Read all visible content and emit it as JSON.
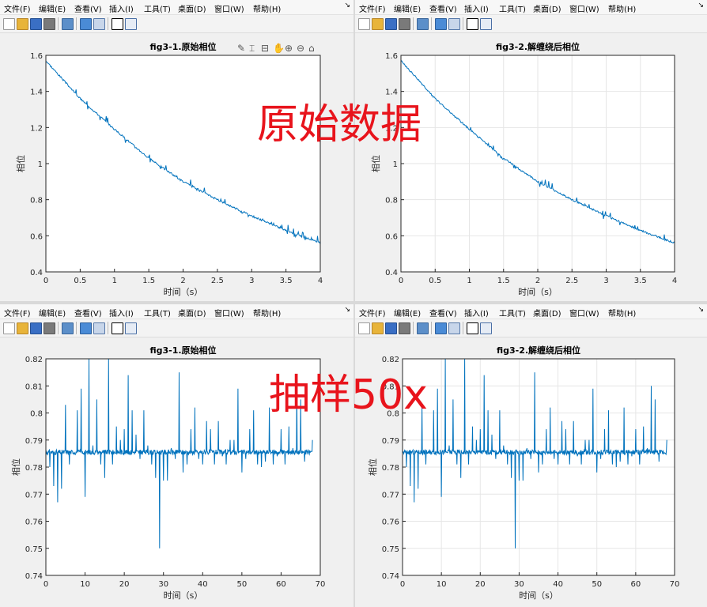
{
  "menu": [
    "文件(F)",
    "编辑(E)",
    "查看(V)",
    "插入(I)",
    "工具(T)",
    "桌面(D)",
    "窗口(W)",
    "帮助(H)"
  ],
  "menu_arrow": "↘",
  "overlay_top": "原始数据",
  "overlay_bottom": "抽样50x",
  "colors": {
    "line": "#0072bd",
    "overlay": "#e8141c",
    "grid": "#e6e6e6"
  },
  "windows": {
    "tl": {
      "chart": {
        "title": "fig3-1.原始相位",
        "xlabel": "时间（s）",
        "ylabel": "相位",
        "xticks": [
          "0",
          "0.5",
          "1",
          "1.5",
          "2",
          "2.5",
          "3",
          "3.5",
          "4"
        ],
        "yticks": [
          "0.4",
          "0.6",
          "0.8",
          "1",
          "1.2",
          "1.4",
          "1.6"
        ]
      }
    },
    "tr": {
      "chart": {
        "title": "fig3-2.解缠绕后相位",
        "xlabel": "时间（s）",
        "ylabel": "相位",
        "xticks": [
          "0",
          "0.5",
          "1",
          "1.5",
          "2",
          "2.5",
          "3",
          "3.5",
          "4"
        ],
        "yticks": [
          "0.4",
          "0.6",
          "0.8",
          "1",
          "1.2",
          "1.4",
          "1.6"
        ]
      }
    },
    "bl": {
      "chart": {
        "title": "fig3-1.原始相位",
        "xlabel": "时间（s）",
        "ylabel": "相位",
        "xticks": [
          "0",
          "10",
          "20",
          "30",
          "40",
          "50",
          "60",
          "70"
        ],
        "yticks": [
          "0.74",
          "0.75",
          "0.76",
          "0.77",
          "0.78",
          "0.79",
          "0.8",
          "0.81",
          "0.82"
        ]
      }
    },
    "br": {
      "chart": {
        "title": "fig3-2.解缠绕后相位",
        "xlabel": "时间（s）",
        "ylabel": "相位",
        "xticks": [
          "0",
          "10",
          "20",
          "30",
          "40",
          "50",
          "60",
          "70"
        ],
        "yticks": [
          "0.74",
          "0.75",
          "0.76",
          "0.77",
          "0.78",
          "0.79",
          "0.8",
          "0.81",
          "0.82"
        ]
      }
    }
  },
  "chart_data": [
    {
      "type": "line",
      "title": "fig3-1.原始相位",
      "xlabel": "时间（s）",
      "ylabel": "相位",
      "xlim": [
        0,
        4
      ],
      "ylim": [
        0.4,
        1.6
      ],
      "grid": false,
      "x": [
        0,
        0.5,
        1,
        1.5,
        2,
        2.5,
        3,
        3.5,
        4
      ],
      "series": [
        {
          "values": [
            1.57,
            1.36,
            1.19,
            1.03,
            0.9,
            0.8,
            0.71,
            0.63,
            0.56
          ]
        }
      ]
    },
    {
      "type": "line",
      "title": "fig3-2.解缠绕后相位",
      "xlabel": "时间（s）",
      "ylabel": "相位",
      "xlim": [
        0,
        4
      ],
      "ylim": [
        0.4,
        1.6
      ],
      "grid": true,
      "x": [
        0,
        0.5,
        1,
        1.5,
        2,
        2.5,
        3,
        3.5,
        4
      ],
      "series": [
        {
          "values": [
            1.57,
            1.36,
            1.19,
            1.03,
            0.9,
            0.8,
            0.71,
            0.63,
            0.56
          ]
        }
      ]
    },
    {
      "type": "line",
      "title": "fig3-1.原始相位",
      "xlabel": "时间（s）",
      "ylabel": "相位",
      "xlim": [
        0,
        70
      ],
      "ylim": [
        0.74,
        0.82
      ],
      "grid": false,
      "baseline": 0.7855,
      "spikes": [
        [
          1,
          0.78
        ],
        [
          2,
          0.773
        ],
        [
          3,
          0.767
        ],
        [
          4,
          0.772
        ],
        [
          5,
          0.803
        ],
        [
          6,
          0.781
        ],
        [
          7,
          0.785
        ],
        [
          8,
          0.801
        ],
        [
          9,
          0.809
        ],
        [
          10,
          0.769
        ],
        [
          11,
          0.82
        ],
        [
          12,
          0.788
        ],
        [
          13,
          0.805
        ],
        [
          14,
          0.781
        ],
        [
          15,
          0.776
        ],
        [
          16,
          0.82
        ],
        [
          17,
          0.781
        ],
        [
          18,
          0.795
        ],
        [
          19,
          0.79
        ],
        [
          20,
          0.794
        ],
        [
          21,
          0.814
        ],
        [
          22,
          0.801
        ],
        [
          23,
          0.792
        ],
        [
          24,
          0.783
        ],
        [
          25,
          0.801
        ],
        [
          26,
          0.788
        ],
        [
          27,
          0.781
        ],
        [
          28,
          0.776
        ],
        [
          29,
          0.75
        ],
        [
          30,
          0.775
        ],
        [
          31,
          0.775
        ],
        [
          32,
          0.787
        ],
        [
          33,
          0.783
        ],
        [
          34,
          0.815
        ],
        [
          35,
          0.778
        ],
        [
          36,
          0.781
        ],
        [
          37,
          0.794
        ],
        [
          38,
          0.802
        ],
        [
          39,
          0.783
        ],
        [
          40,
          0.781
        ],
        [
          41,
          0.797
        ],
        [
          42,
          0.794
        ],
        [
          43,
          0.781
        ],
        [
          44,
          0.797
        ],
        [
          45,
          0.784
        ],
        [
          46,
          0.781
        ],
        [
          47,
          0.79
        ],
        [
          48,
          0.79
        ],
        [
          49,
          0.809
        ],
        [
          50,
          0.778
        ],
        [
          51,
          0.783
        ],
        [
          52,
          0.794
        ],
        [
          53,
          0.801
        ],
        [
          54,
          0.781
        ],
        [
          55,
          0.78
        ],
        [
          56,
          0.782
        ],
        [
          57,
          0.802
        ],
        [
          58,
          0.781
        ],
        [
          59,
          0.784
        ],
        [
          60,
          0.794
        ],
        [
          61,
          0.781
        ],
        [
          62,
          0.795
        ],
        [
          63,
          0.787
        ],
        [
          64,
          0.81
        ],
        [
          65,
          0.805
        ],
        [
          66,
          0.782
        ],
        [
          67,
          0.786
        ],
        [
          68,
          0.79
        ]
      ]
    },
    {
      "type": "line",
      "title": "fig3-2.解缠绕后相位",
      "xlabel": "时间（s）",
      "ylabel": "相位",
      "xlim": [
        0,
        70
      ],
      "ylim": [
        0.74,
        0.82
      ],
      "grid": true,
      "baseline": 0.7855,
      "spikes": [
        [
          1,
          0.78
        ],
        [
          2,
          0.773
        ],
        [
          3,
          0.767
        ],
        [
          4,
          0.772
        ],
        [
          5,
          0.803
        ],
        [
          6,
          0.781
        ],
        [
          7,
          0.785
        ],
        [
          8,
          0.801
        ],
        [
          9,
          0.809
        ],
        [
          10,
          0.769
        ],
        [
          11,
          0.82
        ],
        [
          12,
          0.788
        ],
        [
          13,
          0.805
        ],
        [
          14,
          0.781
        ],
        [
          15,
          0.776
        ],
        [
          16,
          0.82
        ],
        [
          17,
          0.781
        ],
        [
          18,
          0.795
        ],
        [
          19,
          0.79
        ],
        [
          20,
          0.794
        ],
        [
          21,
          0.814
        ],
        [
          22,
          0.801
        ],
        [
          23,
          0.792
        ],
        [
          24,
          0.783
        ],
        [
          25,
          0.801
        ],
        [
          26,
          0.788
        ],
        [
          27,
          0.781
        ],
        [
          28,
          0.776
        ],
        [
          29,
          0.75
        ],
        [
          30,
          0.775
        ],
        [
          31,
          0.775
        ],
        [
          32,
          0.787
        ],
        [
          33,
          0.783
        ],
        [
          34,
          0.815
        ],
        [
          35,
          0.778
        ],
        [
          36,
          0.781
        ],
        [
          37,
          0.794
        ],
        [
          38,
          0.802
        ],
        [
          39,
          0.783
        ],
        [
          40,
          0.781
        ],
        [
          41,
          0.797
        ],
        [
          42,
          0.794
        ],
        [
          43,
          0.781
        ],
        [
          44,
          0.797
        ],
        [
          45,
          0.784
        ],
        [
          46,
          0.781
        ],
        [
          47,
          0.79
        ],
        [
          48,
          0.79
        ],
        [
          49,
          0.809
        ],
        [
          50,
          0.778
        ],
        [
          51,
          0.783
        ],
        [
          52,
          0.794
        ],
        [
          53,
          0.801
        ],
        [
          54,
          0.781
        ],
        [
          55,
          0.78
        ],
        [
          56,
          0.782
        ],
        [
          57,
          0.802
        ],
        [
          58,
          0.781
        ],
        [
          59,
          0.784
        ],
        [
          60,
          0.794
        ],
        [
          61,
          0.781
        ],
        [
          62,
          0.795
        ],
        [
          63,
          0.787
        ],
        [
          64,
          0.81
        ],
        [
          65,
          0.805
        ],
        [
          66,
          0.782
        ],
        [
          67,
          0.786
        ],
        [
          68,
          0.79
        ]
      ]
    }
  ]
}
